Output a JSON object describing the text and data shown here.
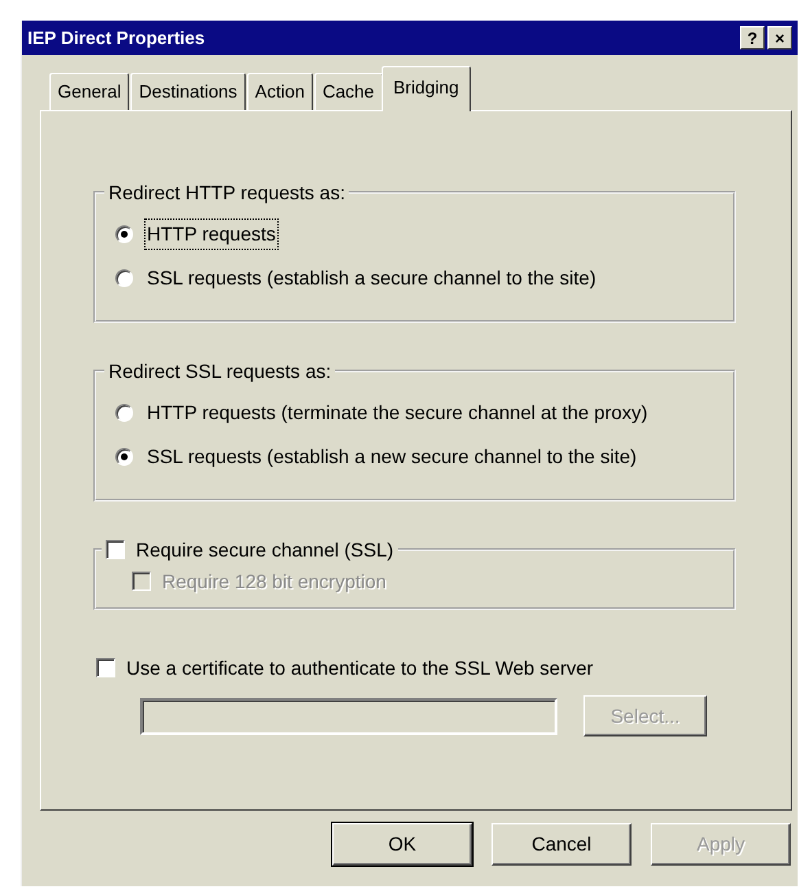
{
  "window": {
    "title": "IEP Direct Properties",
    "help_button": "?",
    "close_button": "×"
  },
  "tabs": [
    {
      "label": "General",
      "selected": false
    },
    {
      "label": "Destinations",
      "selected": false
    },
    {
      "label": "Action",
      "selected": false
    },
    {
      "label": "Cache",
      "selected": false
    },
    {
      "label": "Bridging",
      "selected": true
    }
  ],
  "groups": [
    {
      "legend": "Redirect HTTP requests as:",
      "options": [
        {
          "label": "HTTP requests",
          "selected": true,
          "focused": true
        },
        {
          "label": "SSL requests (establish a secure channel to the site)",
          "selected": false,
          "focused": false
        }
      ]
    },
    {
      "legend": "Redirect SSL requests as:",
      "options": [
        {
          "label": "HTTP requests (terminate the secure channel at the proxy)",
          "selected": false,
          "focused": false
        },
        {
          "label": "SSL requests (establish a new secure channel to the site)",
          "selected": true,
          "focused": false
        }
      ]
    }
  ],
  "secure_channel": {
    "label": "Require secure channel (SSL)",
    "checked": false,
    "disabled": false,
    "encryption": {
      "label": "Require 128 bit encryption",
      "checked": false,
      "disabled": true
    }
  },
  "certificate": {
    "label": "Use a certificate to authenticate to the SSL Web server",
    "checked": false,
    "disabled": false,
    "field_disabled": true,
    "select_button": {
      "label": "Select...",
      "disabled": true
    }
  },
  "buttons": [
    {
      "label": "OK",
      "disabled": false,
      "default": true
    },
    {
      "label": "Cancel",
      "disabled": false,
      "default": false
    },
    {
      "label": "Apply",
      "disabled": true,
      "default": false
    }
  ]
}
